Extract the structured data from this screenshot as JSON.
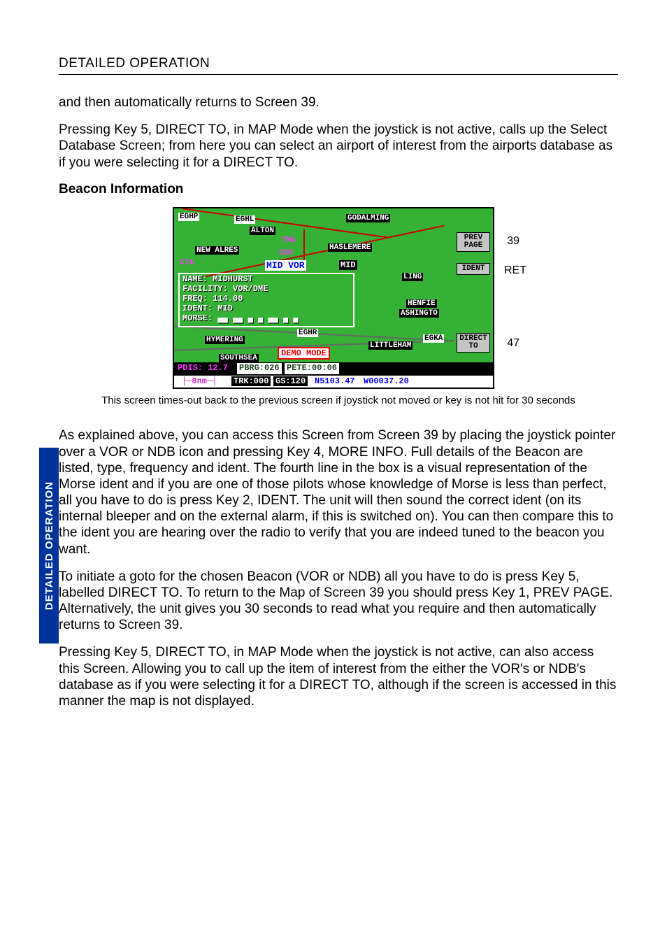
{
  "header": {
    "title": "DETAILED OPERATION"
  },
  "side_tab": "DETAILED OPERATION",
  "paragraphs": {
    "p1": "and then automatically returns to Screen 39.",
    "p2": "Pressing Key 5, DIRECT TO, in MAP Mode when the joystick is not active, calls up the Select Database Screen; from here you can select an airport of interest from the airports database as if you were selecting it for a DIRECT TO.",
    "h1": "Beacon Information",
    "caption": "This screen times-out back to the previous screen if joystick not moved or key is not hit for 30 seconds",
    "p3": "As explained above, you can access this Screen from Screen 39 by placing the joystick pointer over a VOR or NDB icon and pressing Key 4, MORE INFO.  Full details of the Beacon are listed, type, frequency and ident.  The fourth line in the box is a visual representation of the Morse ident and if you are one of those pilots whose knowledge of Morse is less than perfect, all you have to do is press Key 2, IDENT. The unit will then sound the correct ident (on its internal bleeper and on the external alarm, if this is switched on). You can then compare this to the ident you are hearing over the radio to verify that you are indeed tuned to the beacon you want.",
    "p4": "To initiate a goto for the chosen Beacon (VOR or NDB) all you have to do is press Key 5, labelled DIRECT TO.  To return to the Map of Screen 39 you should press Key 1, PREV PAGE.  Alternatively, the unit gives you 30 seconds to read what you require and then automatically returns to Screen 39.",
    "p5": "Pressing Key 5, DIRECT TO, in MAP Mode when the joystick is not active, can also access this Screen.  Allowing you to call up the item of interest from the either the VOR's or NDB's database as if you were selecting it for a DIRECT TO, although if the screen is accessed in this manner the map is not displayed."
  },
  "softkeys": {
    "a": "PREV\nPAGE",
    "b": "IDENT",
    "c": "DIRECT\nTO"
  },
  "outer_labels": {
    "top": "39",
    "mid": "RET",
    "bot": "47"
  },
  "map_chips": {
    "eghp": "EGHP",
    "eghl": "EGHL",
    "godalming": "GODALMING",
    "alton": "ALTON",
    "tma": "TMA",
    "haslemere": "HASLEMERE",
    "new_alres": "NEW ALRES",
    "dgr": "DGR",
    "cta": "CTA",
    "ling": "LING",
    "henfie": "HENFIE",
    "ashingto": "ASHINGTO",
    "eghr": "EGHR",
    "egka": "EGKA",
    "littleham": "LITTLEHAM",
    "hymering": "HYMERING",
    "southsea": "SOUTHSEA"
  },
  "info_title": "MID  VOR",
  "mid_box": "MID",
  "info": {
    "name": "NAME: MIDHURST",
    "facility": "FACILITY: VOR/DME",
    "freq": "FREQ: 114.00",
    "ident": "IDENT: MID",
    "morse": "MORSE: ▄▄ ▄▄   ▄ ▄   ▄▄ ▄ ▄"
  },
  "demo": "DEMO MODE",
  "bar1": {
    "pdis": "PDIS: 12.7",
    "pbrg": "PBRG:026",
    "pete": "PETE:00:06"
  },
  "bar2": {
    "scale": "8nm",
    "trk": "TRK:000",
    "gs": "GS:120",
    "lat": "N5103.47",
    "lon": "W00037.20"
  }
}
